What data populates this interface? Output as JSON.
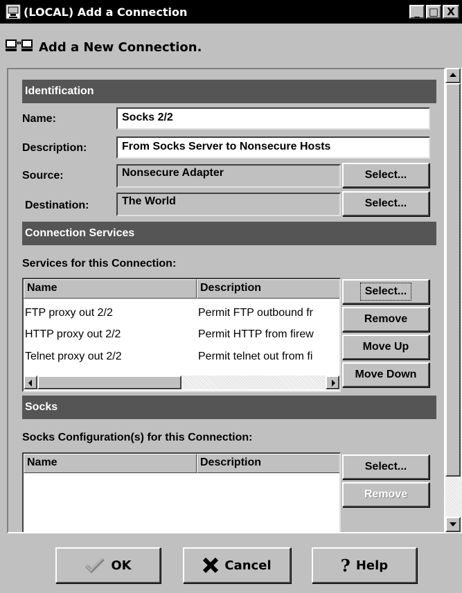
{
  "window": {
    "title": "(LOCAL) Add a Connection",
    "minimize": "_",
    "maximize": "□",
    "close": "X"
  },
  "header": {
    "title": "Add a New Connection.",
    "icon": "computers-connection-icon"
  },
  "identification": {
    "section_label": "Identification",
    "name_label": "Name:",
    "name_value": "Socks 2/2",
    "description_label": "Description:",
    "description_value": "From Socks Server to Nonsecure Hosts",
    "source_label": "Source:",
    "source_value": "Nonsecure Adapter",
    "source_select": "Select...",
    "destination_label": "Destination:",
    "destination_value": "The World",
    "destination_select": "Select..."
  },
  "connection_services": {
    "section_label": "Connection Services",
    "list_label": "Services for this Connection:",
    "columns": [
      "Name",
      "Description"
    ],
    "rows": [
      {
        "name": "FTP proxy out 2/2",
        "description": "Permit FTP outbound fr"
      },
      {
        "name": "HTTP proxy out 2/2",
        "description": "Permit HTTP from firew"
      },
      {
        "name": "Telnet proxy out 2/2",
        "description": "Permit telnet out from fi"
      }
    ],
    "buttons": {
      "select": "Select...",
      "remove": "Remove",
      "move_up": "Move Up",
      "move_down": "Move Down"
    }
  },
  "socks": {
    "section_label": "Socks",
    "list_label": "Socks Configuration(s) for this Connection:",
    "columns": [
      "Name",
      "Description"
    ],
    "rows": [],
    "buttons": {
      "select": "Select...",
      "remove": "Remove"
    }
  },
  "footer": {
    "ok": "OK",
    "cancel": "Cancel",
    "help": "Help"
  },
  "colors": {
    "section_bar": "#555555",
    "window_bg": "#c0c0c0",
    "titlebar": "#000000"
  }
}
